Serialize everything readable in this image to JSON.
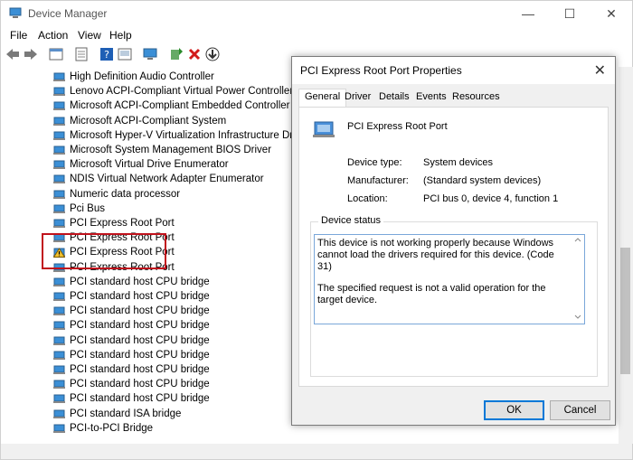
{
  "window": {
    "title": "Device Manager",
    "controls": [
      "—",
      "☐",
      "✕"
    ]
  },
  "menu": [
    "File",
    "Action",
    "View",
    "Help"
  ],
  "tree_items": [
    {
      "label": "High Definition Audio Controller",
      "warning": false
    },
    {
      "label": "Lenovo ACPI-Compliant Virtual Power Controller",
      "warning": false
    },
    {
      "label": "Microsoft ACPI-Compliant Embedded Controller",
      "warning": false
    },
    {
      "label": "Microsoft ACPI-Compliant System",
      "warning": false
    },
    {
      "label": "Microsoft Hyper-V Virtualization Infrastructure Driver",
      "warning": false
    },
    {
      "label": "Microsoft System Management BIOS Driver",
      "warning": false
    },
    {
      "label": "Microsoft Virtual Drive Enumerator",
      "warning": false
    },
    {
      "label": "NDIS Virtual Network Adapter Enumerator",
      "warning": false
    },
    {
      "label": "Numeric data processor",
      "warning": false
    },
    {
      "label": "Pci Bus",
      "warning": false
    },
    {
      "label": "PCI Express Root Port",
      "warning": false
    },
    {
      "label": "PCI Express Root Port",
      "warning": false
    },
    {
      "label": "PCI Express Root Port",
      "warning": true
    },
    {
      "label": "PCI Express Root Port",
      "warning": false
    },
    {
      "label": "PCI standard host CPU bridge",
      "warning": false
    },
    {
      "label": "PCI standard host CPU bridge",
      "warning": false
    },
    {
      "label": "PCI standard host CPU bridge",
      "warning": false
    },
    {
      "label": "PCI standard host CPU bridge",
      "warning": false
    },
    {
      "label": "PCI standard host CPU bridge",
      "warning": false
    },
    {
      "label": "PCI standard host CPU bridge",
      "warning": false
    },
    {
      "label": "PCI standard host CPU bridge",
      "warning": false
    },
    {
      "label": "PCI standard host CPU bridge",
      "warning": false
    },
    {
      "label": "PCI standard host CPU bridge",
      "warning": false
    },
    {
      "label": "PCI standard ISA bridge",
      "warning": false
    },
    {
      "label": "PCI-to-PCI Bridge",
      "warning": false
    }
  ],
  "dialog": {
    "title": "PCI Express Root Port Properties",
    "tabs": [
      "General",
      "Driver",
      "Details",
      "Events",
      "Resources"
    ],
    "active_tab": "General",
    "device_name": "PCI Express Root Port",
    "properties": [
      {
        "label": "Device type:",
        "value": "System devices"
      },
      {
        "label": "Manufacturer:",
        "value": "(Standard system devices)"
      },
      {
        "label": "Location:",
        "value": "PCI bus 0, device 4, function 1"
      }
    ],
    "status_legend": "Device status",
    "status_line1": "This device is not working properly because Windows cannot load the drivers required for this device. (Code 31)",
    "status_line2": "The specified request is not a valid operation for the target device.",
    "ok_label": "OK",
    "cancel_label": "Cancel"
  },
  "colors": {
    "highlight_border": "#c0121c",
    "focus_blue": "#0078d7"
  }
}
